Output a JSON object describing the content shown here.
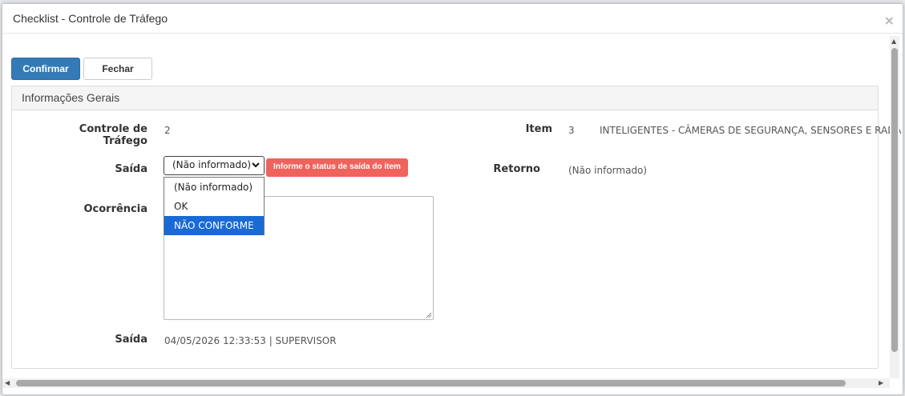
{
  "modal": {
    "title": "Checklist - Controle de Tráfego",
    "close_glyph": "×"
  },
  "toolbar": {
    "confirm_label": "Confirmar",
    "close_label": "Fechar"
  },
  "panel": {
    "heading": "Informações Gerais",
    "controle_label": "Controle de Tráfego",
    "controle_value": "2",
    "item_label": "Item",
    "item_number": "3",
    "item_name": "INTELIGENTES - CÂMERAS DE SEGURANÇA, SENSORES E RADA",
    "saida_label": "Saída",
    "saida_selected": "(Não informado)",
    "saida_error": "Informe o status de saída do item",
    "saida_options": [
      "(Não informado)",
      "OK",
      "NÃO CONFORME"
    ],
    "retorno_label": "Retorno",
    "retorno_value": "(Não informado)",
    "ocorrencia_label": "Ocorrência",
    "ocorrencia_value": "",
    "saida_info_label": "Saída",
    "saida_info_value": "04/05/2026 12:33:53 | SUPERVISOR"
  },
  "colors": {
    "primary": "#337ab7",
    "error": "#f0625c",
    "option_highlight": "#1a6ad6"
  }
}
